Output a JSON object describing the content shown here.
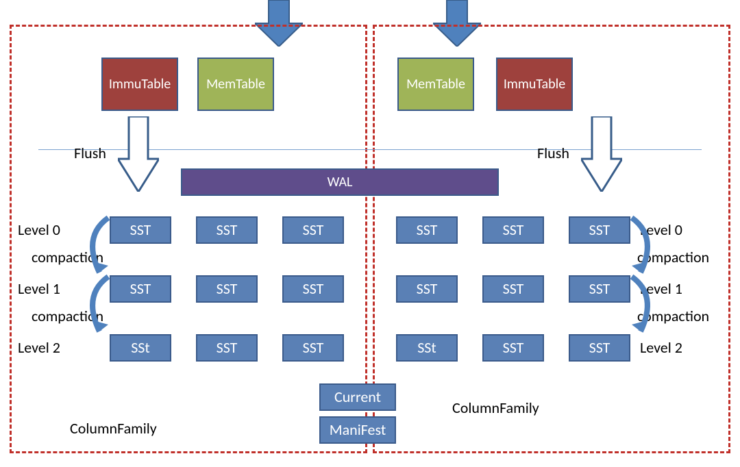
{
  "immutable_label": "ImmuTable",
  "memtable_label": "MemTable",
  "wal_label": "WAL",
  "flush_label": "Flush",
  "sst_label": "SST",
  "sst_typo_label": "SSt",
  "current_label": "Current",
  "manifest_label": "ManiFest",
  "columnfamily_label": "ColumnFamily",
  "level0_label": "Level 0",
  "level1_label": "Level 1",
  "level2_label": "Level 2",
  "compaction_label": "compaction",
  "colors": {
    "dashed_border": "#c0302a",
    "immutable_bg": "#9e413d",
    "memtable_bg": "#9fb458",
    "wal_bg": "#5f4d8b",
    "sst_bg": "#5a80b5",
    "arrow_fill": "#4f81bd",
    "arrow_outline": "#385d8a"
  }
}
